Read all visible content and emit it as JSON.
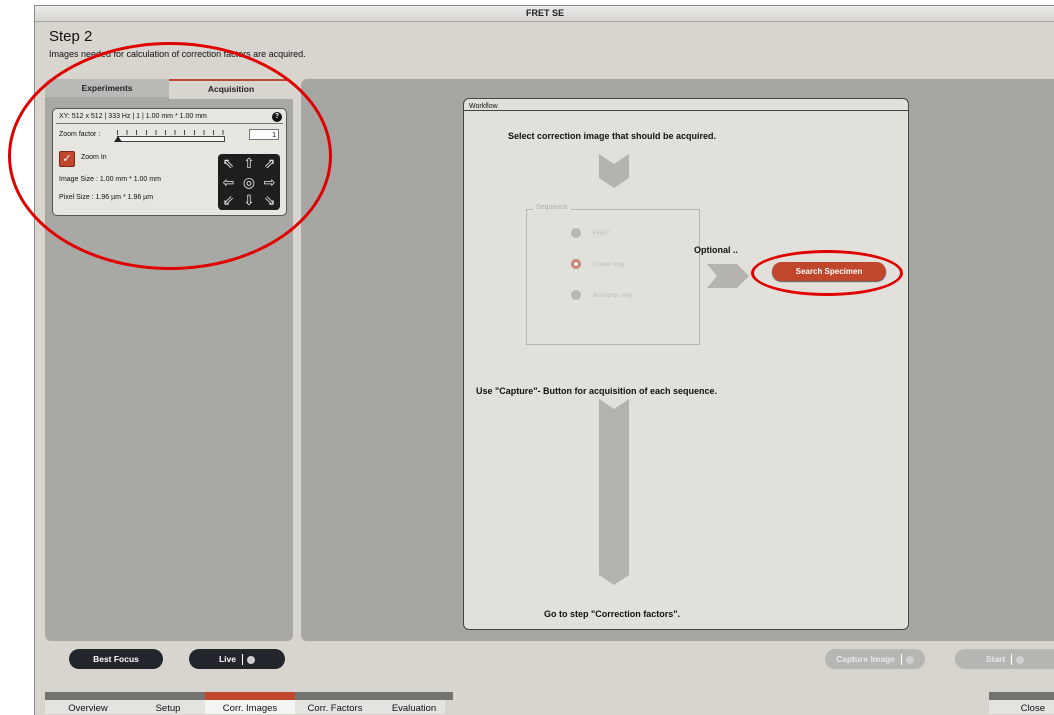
{
  "window": {
    "title": "FRET SE"
  },
  "step": {
    "title": "Step 2",
    "subtitle": "Images needed for calculation of correction factors are acquired."
  },
  "left_tabs": [
    {
      "label": "Experiments",
      "active": false
    },
    {
      "label": "Acquisition",
      "active": true
    }
  ],
  "acquisition": {
    "scan_info": "XY:  512 x 512 | 333 Hz | 1 | 1.00 mm * 1.00 mm",
    "zoom_label": "Zoom factor :",
    "zoom_value": "1",
    "zoom_in_label": "Zoom In",
    "zoom_in_checked": true,
    "image_size": "Image Size :    1.00 mm * 1.00 mm",
    "pixel_size": "Pixel Size :     1.96 µm * 1.96 µm",
    "dpad_icons": [
      "arrow-up-left-icon",
      "arrow-up-icon",
      "arrow-up-right-icon",
      "arrow-left-icon",
      "center-icon",
      "arrow-right-icon",
      "arrow-down-left-icon",
      "arrow-down-icon",
      "arrow-down-right-icon"
    ]
  },
  "workflow": {
    "title": "Workflow",
    "select_text": "Select correction image that should be acquired.",
    "sequence_label": "Sequence",
    "sequence_options": [
      {
        "label": "FRET",
        "selected": false
      },
      {
        "label": "Donor only",
        "selected": true
      },
      {
        "label": "Acceptor only",
        "selected": false
      }
    ],
    "optional_text": "Optional ..",
    "search_button": "Search Specimen",
    "capture_text": "Use \"Capture\"- Button for acquisition of each sequence.",
    "goto_text": "Go to step \"Correction factors\"."
  },
  "bottom_buttons": {
    "best_focus": "Best Focus",
    "live": "Live",
    "capture_image": "Capture Image",
    "start": "Start"
  },
  "nav_tabs": [
    {
      "label": "Overview",
      "active": false
    },
    {
      "label": "Setup",
      "active": false
    },
    {
      "label": "Corr. Images",
      "active": true
    },
    {
      "label": "Corr. Factors",
      "active": false
    },
    {
      "label": "Evaluation",
      "active": false
    }
  ],
  "close_label": "Close",
  "colors": {
    "accent": "#c0462c",
    "annotation": "#e00000",
    "panel": "#a8a8a5"
  }
}
